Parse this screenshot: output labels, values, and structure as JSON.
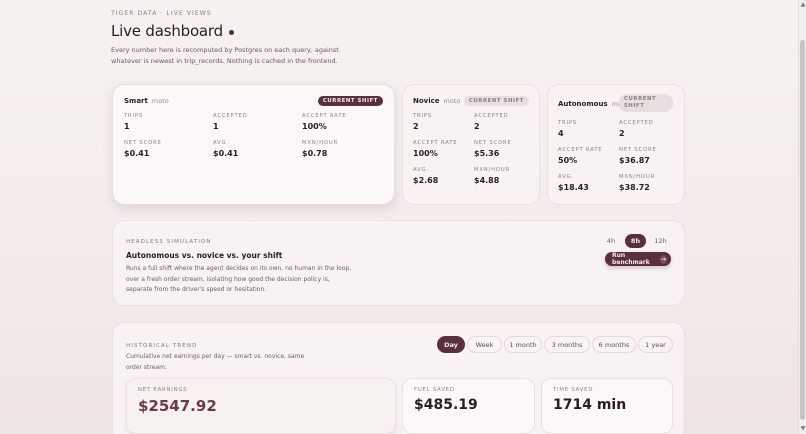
{
  "header": {
    "eyebrow": "TIGER DATA · LIVE VIEWS",
    "title": "Live dashboard",
    "description": "Every number here is recomputed by Postgres on each query, against whatever is newest in trip_records. Nothing is cached in the frontend."
  },
  "modes": [
    {
      "name": "Smart",
      "vehicle": "moto",
      "badge": "CURRENT SHIFT",
      "stats": [
        {
          "label": "TRIPS",
          "value": "1"
        },
        {
          "label": "ACCEPTED",
          "value": "1"
        },
        {
          "label": "ACCEPT RATE",
          "value": "100%"
        },
        {
          "label": "NET SCORE",
          "value": "$0.41"
        },
        {
          "label": "AVG.",
          "value": "$0.41"
        },
        {
          "label": "MXN/HOUR",
          "value": "$0.78"
        }
      ]
    },
    {
      "name": "Novice",
      "vehicle": "moto",
      "badge": "CURRENT SHIFT",
      "stats": [
        {
          "label": "TRIPS",
          "value": "2"
        },
        {
          "label": "ACCEPTED",
          "value": "2"
        },
        {
          "label": "ACCEPT RATE",
          "value": "100%"
        },
        {
          "label": "NET SCORE",
          "value": "$5.36"
        },
        {
          "label": "AVG.",
          "value": "$2.68"
        },
        {
          "label": "MXN/HOUR",
          "value": "$4.88"
        }
      ]
    },
    {
      "name": "Autonomous",
      "vehicle": "moto",
      "badge": "CURRENT SHIFT",
      "stats": [
        {
          "label": "TRIPS",
          "value": "4"
        },
        {
          "label": "ACCEPTED",
          "value": "2"
        },
        {
          "label": "ACCEPT RATE",
          "value": "50%"
        },
        {
          "label": "NET SCORE",
          "value": "$36.87"
        },
        {
          "label": "AVG.",
          "value": "$18.43"
        },
        {
          "label": "MXN/HOUR",
          "value": "$38.72"
        }
      ]
    }
  ],
  "simulation": {
    "eyebrow": "HEADLESS SIMULATION",
    "title": "Autonomous vs. novice vs. your shift",
    "description": "Runs a full shift where the agent decides on its own, no human in the loop, over a fresh order stream, isolating how good the decision policy is, separate from the driver's speed or hesitation.",
    "durations": [
      "4h",
      "8h",
      "12h"
    ],
    "selected_duration": "8h",
    "run_label": "Run benchmark",
    "run_icon": "arrow-right-icon"
  },
  "trend": {
    "eyebrow": "HISTORICAL TREND",
    "description": "Cumulative net earnings per day — smart vs. novice, same order stream.",
    "ranges": [
      "Day",
      "Week",
      "1 month",
      "3 months",
      "6 months",
      "1 year"
    ],
    "selected_range": "Day",
    "metrics": [
      {
        "label": "NET EARNINGS",
        "value": "$2547.92"
      },
      {
        "label": "FUEL SAVED",
        "value": "$485.19"
      },
      {
        "label": "TIME SAVED",
        "value": "1714 min"
      }
    ]
  },
  "colors": {
    "accent": "#5a2f3f",
    "background": "#f5efee"
  }
}
